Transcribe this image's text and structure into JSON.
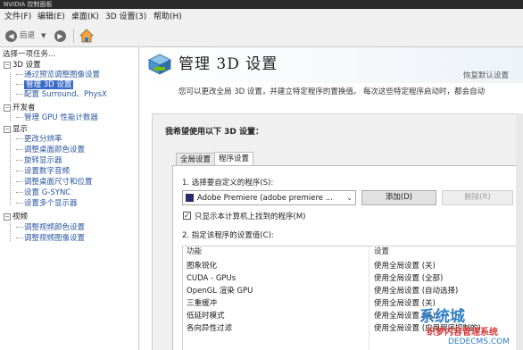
{
  "window": {
    "title": "NVIDIA 控制面板"
  },
  "menu": {
    "items": [
      "文件(F)",
      "编辑(E)",
      "桌面(K)",
      "3D 设置(3)",
      "帮助(H)"
    ]
  },
  "toolbar": {
    "back_label": "后退",
    "home_icon": "home-icon"
  },
  "tree": {
    "header": "选择一项任务...",
    "categories": [
      {
        "label": "3D 设置",
        "items": [
          "通过预览调整图像设置",
          "管理 3D 设置",
          "配置 Surround、PhysX"
        ]
      },
      {
        "label": "开发者",
        "items": [
          "管理 GPU 性能计数器"
        ]
      },
      {
        "label": "显示",
        "items": [
          "更改分辨率",
          "调整桌面颜色设置",
          "旋转显示器",
          "设置数字音频",
          "调整桌面尺寸和位置",
          "设置 G-SYNC",
          "设置多个显示器"
        ]
      },
      {
        "label": "视频",
        "items": [
          "调整视频颜色设置",
          "调整视频图像设置"
        ]
      }
    ],
    "selected": "管理 3D 设置"
  },
  "header": {
    "title": "管理 3D 设置",
    "restore_label": "恢复默认设置"
  },
  "description": "您可以更改全局 3D 设置，并建立特定程序的置换值。 每次这些特定程序启动时，都会自动",
  "content": {
    "question": "我希望使用以下 3D 设置：",
    "tabs": [
      "全局设置",
      "程序设置"
    ],
    "active_tab": "程序设置",
    "step1_label": "1. 选择要自定义的程序(S):",
    "program_value": "Adobe Premiere (adobe premiere ...",
    "add_button": "添加(D)",
    "remove_button": "删除(R)",
    "checkbox_label": "只显示本计算机上找到的程序(M)",
    "checkbox_checked": true,
    "step2_label": "2. 指定该程序的设置值(C):",
    "grid_headers": [
      "功能",
      "设置"
    ],
    "grid_rows": [
      [
        "图象锐化",
        "使用全局设置 (关)"
      ],
      [
        "CUDA - GPUs",
        "使用全局设置 (全部)"
      ],
      [
        "OpenGL 渲染 GPU",
        "使用全局设置 (自动选择)"
      ],
      [
        "三重缓冲",
        "使用全局设置 (关)"
      ],
      [
        "低延时模式",
        "使用全局设置 (关)"
      ],
      [
        "各向异性过滤",
        "使用全局设置 (应用程序控制的)"
      ]
    ]
  },
  "watermark": {
    "line1": "系统城",
    "line2": "织梦内容管理系统",
    "line3": "DEDECMS.COM"
  }
}
